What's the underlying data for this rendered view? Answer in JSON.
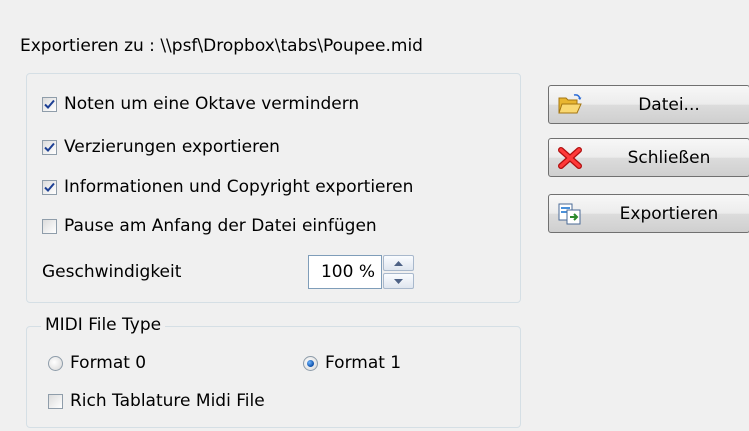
{
  "export_path_label": "Exportieren zu : \\\\psf\\Dropbox\\tabs\\Poupee.mid",
  "options": [
    {
      "label": "Noten um eine Oktave vermindern",
      "checked": true
    },
    {
      "label": "Verzierungen exportieren",
      "checked": true
    },
    {
      "label": "Informationen und Copyright exportieren",
      "checked": true
    },
    {
      "label": "Pause am Anfang der Datei einfügen",
      "checked": false
    }
  ],
  "speed": {
    "label": "Geschwindigkeit",
    "value": "100 %"
  },
  "midi": {
    "legend": "MIDI File Type",
    "format0": {
      "label": "Format 0",
      "selected": false
    },
    "format1": {
      "label": "Format 1",
      "selected": true
    },
    "rich_tablature": {
      "label": "Rich Tablature Midi File",
      "checked": false
    }
  },
  "buttons": {
    "file": {
      "label": "Datei...",
      "icon": "folder-open-icon"
    },
    "close": {
      "label": "Schließen",
      "icon": "red-x-icon"
    },
    "export": {
      "label": "Exportieren",
      "icon": "export-document-icon"
    }
  },
  "colors": {
    "check": "#1c3f94",
    "accent": "#0c4ea8",
    "close_red": "#e02020"
  }
}
